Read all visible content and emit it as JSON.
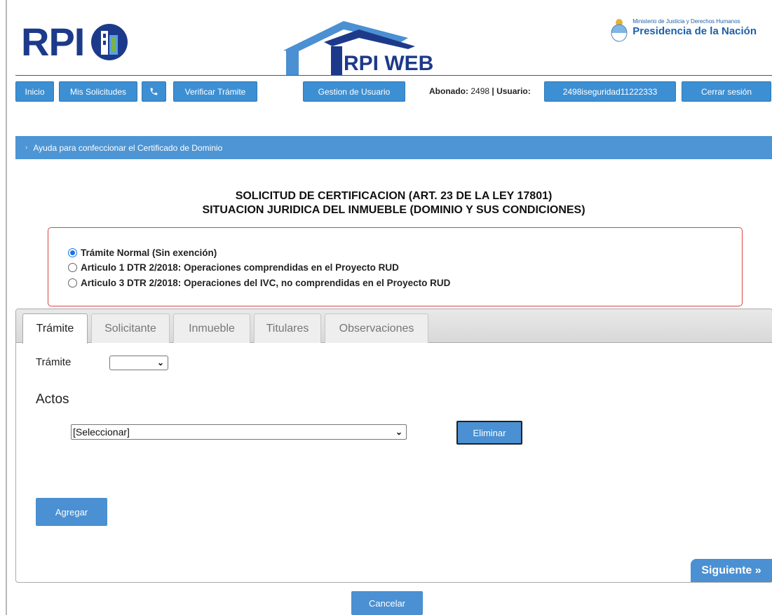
{
  "header": {
    "logo_text": "RPI",
    "web_logo_text": "RPI WEB",
    "ministry": "Ministerio de Justicia y Derechos Humanos",
    "presidency": "Presidencia de la Nación"
  },
  "nav": {
    "inicio": "Inicio",
    "mis_solicitudes": "Mis Solicitudes",
    "phone_icon": "phone-icon",
    "verificar": "Verificar Trámite",
    "gestion": "Gestion de Usuario",
    "abonado_label": "Abonado:",
    "abonado_value": "2498",
    "usuario_label": "| Usuario:",
    "usuario_value": "2498iseguridad11222333",
    "cerrar": "Cerrar sesión"
  },
  "help_bar": {
    "label": "Ayuda para confeccionar el Certificado de Dominio"
  },
  "title": {
    "line1": "SOLICITUD DE CERTIFICACION (ART. 23 DE LA LEY 17801)",
    "line2": "SITUACION JURIDICA DEL INMUEBLE (DOMINIO Y SUS CONDICIONES)"
  },
  "options": [
    {
      "label": "Trámite Normal (Sin exención)",
      "checked": true
    },
    {
      "label": "Articulo 1 DTR 2/2018: Operaciones comprendidas en el Proyecto RUD",
      "checked": false
    },
    {
      "label": "Articulo 3 DTR 2/2018: Operaciones del IVC, no comprendidas en el Proyecto RUD",
      "checked": false
    }
  ],
  "tabs": [
    "Trámite",
    "Solicitante",
    "Inmueble",
    "Titulares",
    "Observaciones"
  ],
  "form": {
    "tramite_label": "Trámite",
    "tramite_value": "",
    "actos_title": "Actos",
    "actos_select": "[Seleccionar]",
    "eliminar": "Eliminar",
    "agregar": "Agregar"
  },
  "footer": {
    "siguiente": "Siguiente »",
    "cancelar": "Cancelar"
  },
  "colors": {
    "accent": "#4a90d2",
    "brand_dark": "#1d3a8a",
    "option_border": "#dd4444"
  }
}
